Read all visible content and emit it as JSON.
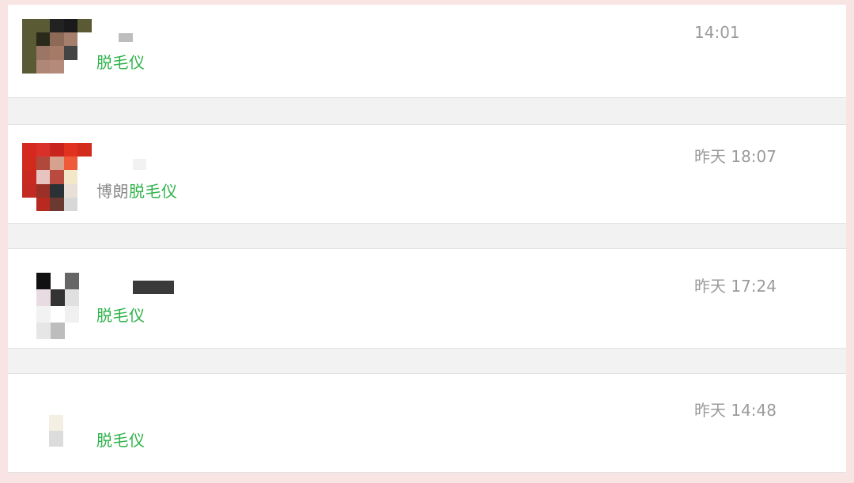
{
  "chats": [
    {
      "prefix": "",
      "keyword": "脱毛仪",
      "time": "14:01"
    },
    {
      "prefix": "博朗",
      "keyword": "脱毛仪",
      "time": "昨天 18:07"
    },
    {
      "prefix": "",
      "keyword": "脱毛仪",
      "time": "昨天 17:24"
    },
    {
      "prefix": "",
      "keyword": "脱毛仪",
      "time": "昨天 14:48"
    }
  ],
  "colors": {
    "keyword": "#2fb34a",
    "background": "#f9e4e4"
  }
}
